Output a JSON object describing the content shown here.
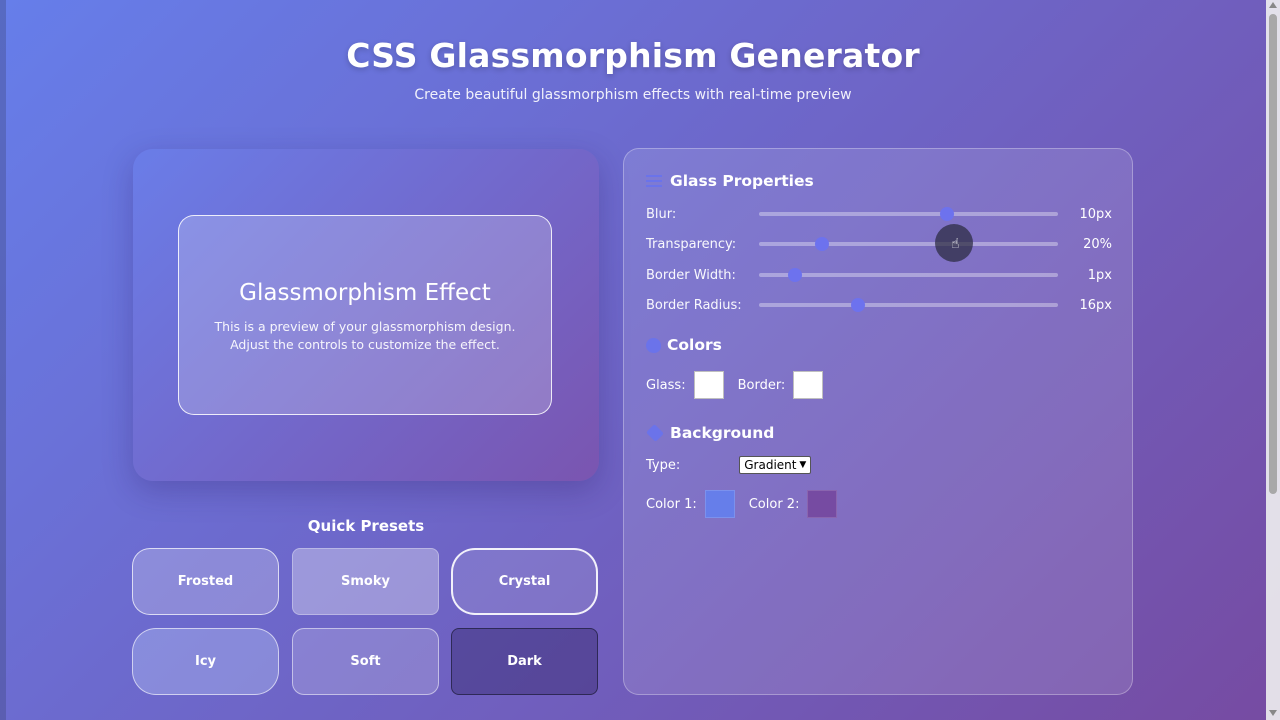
{
  "header": {
    "title": "CSS Glassmorphism Generator",
    "subtitle": "Create beautiful glassmorphism effects with real-time preview"
  },
  "preview": {
    "title": "Glassmorphism Effect",
    "description": "This is a preview of your glassmorphism design. Adjust the controls to customize the effect."
  },
  "presets": {
    "title": "Quick Presets",
    "items": [
      "Frosted",
      "Smoky",
      "Crystal",
      "Icy",
      "Soft",
      "Dark"
    ]
  },
  "glass_properties": {
    "title": "Glass Properties",
    "icon": "sliders-icon",
    "sliders": [
      {
        "label": "Blur:",
        "value": "10px",
        "level": 0.63
      },
      {
        "label": "Transparency:",
        "value": "20%",
        "level": 0.21
      },
      {
        "label": "Border Width:",
        "value": "1px",
        "level": 0.12
      },
      {
        "label": "Border Radius:",
        "value": "16px",
        "level": 0.33
      }
    ]
  },
  "colors": {
    "title": "Colors",
    "icon": "palette-icon",
    "glass_label": "Glass:",
    "glass_color": "#ffffff",
    "border_label": "Border:",
    "border_color": "#ffffff"
  },
  "background": {
    "title": "Background",
    "icon": "fill-drip-icon",
    "type_label": "Type:",
    "type_value": "Gradient",
    "color1_label": "Color 1:",
    "color1": "#667eea",
    "color2_label": "Color 2:",
    "color2": "#764ba2"
  },
  "theme": {
    "accent": "#6d72ee",
    "gradient_start": "#667eea",
    "gradient_end": "#764ba2"
  }
}
